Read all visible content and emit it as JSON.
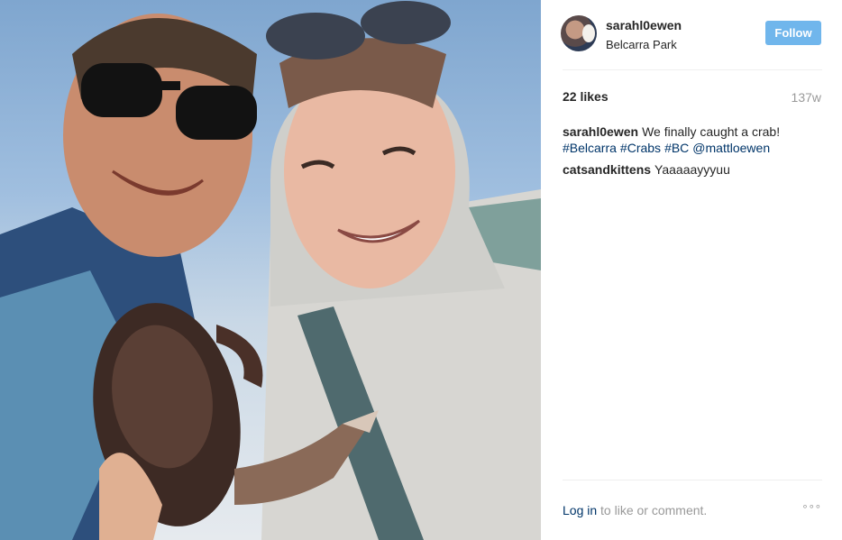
{
  "post": {
    "username": "sarahl0ewen",
    "location": "Belcarra Park",
    "follow_label": "Follow",
    "likes": "22 likes",
    "age": "137w",
    "caption": {
      "user": "sarahl0ewen",
      "text": "We finally caught a crab!",
      "tags": [
        "#Belcarra",
        "#Crabs",
        "#BC",
        "@mattloewen"
      ]
    },
    "comments": [
      {
        "user": "catsandkittens",
        "text": "Yaaaaayyyuu"
      }
    ],
    "footer": {
      "login_label": "Log in",
      "rest_text": " to like or comment.",
      "more_label": "°°°"
    }
  },
  "icons": [
    "avatar",
    "more-options-icon"
  ],
  "colors": {
    "follow_button": "#70b6ec",
    "link": "#003569",
    "muted": "#999999"
  }
}
